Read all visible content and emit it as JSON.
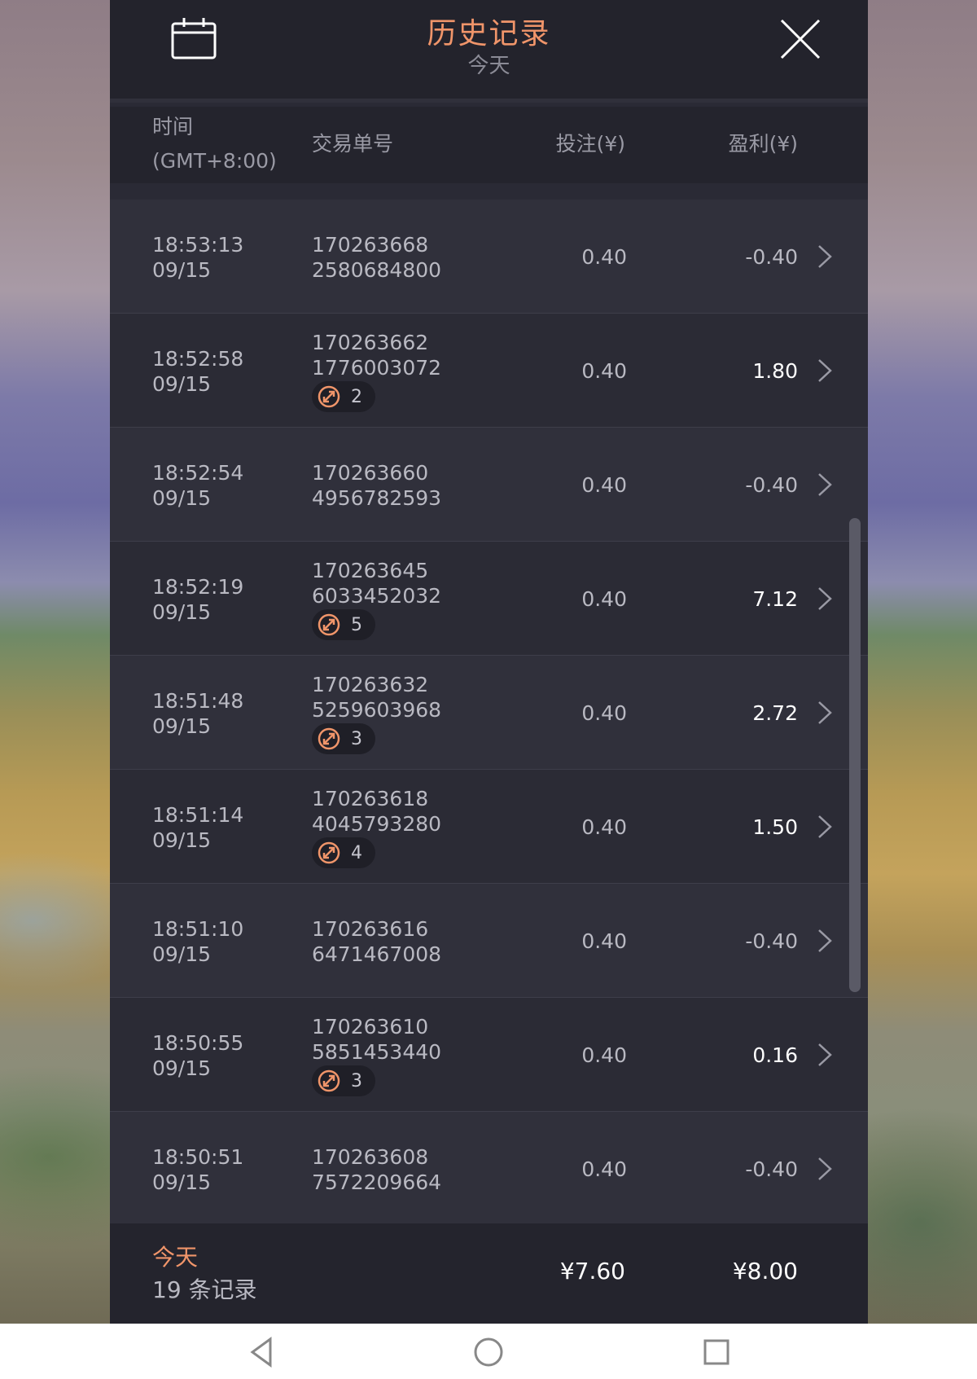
{
  "header": {
    "title": "历史记录",
    "subtitle": "今天",
    "calendar_icon": "calendar-icon",
    "close_icon": "close-icon"
  },
  "table": {
    "headers": {
      "time": "时间",
      "timezone": "(GMT+8:00)",
      "order": "交易单号",
      "bet": "投注(¥)",
      "profit": "盈利(¥)"
    },
    "rows": [
      {
        "time": "18:53:13",
        "date": "09/15",
        "order_1": "170263668",
        "order_2": "2580684800",
        "bet": "0.40",
        "profit": "-0.40"
      },
      {
        "time": "18:52:58",
        "date": "09/15",
        "order_1": "170263662",
        "order_2": "1776003072",
        "badge": "2",
        "bet": "0.40",
        "profit": "1.80"
      },
      {
        "time": "18:52:54",
        "date": "09/15",
        "order_1": "170263660",
        "order_2": "4956782593",
        "bet": "0.40",
        "profit": "-0.40"
      },
      {
        "time": "18:52:19",
        "date": "09/15",
        "order_1": "170263645",
        "order_2": "6033452032",
        "badge": "5",
        "bet": "0.40",
        "profit": "7.12"
      },
      {
        "time": "18:51:48",
        "date": "09/15",
        "order_1": "170263632",
        "order_2": "5259603968",
        "badge": "3",
        "bet": "0.40",
        "profit": "2.72"
      },
      {
        "time": "18:51:14",
        "date": "09/15",
        "order_1": "170263618",
        "order_2": "4045793280",
        "badge": "4",
        "bet": "0.40",
        "profit": "1.50"
      },
      {
        "time": "18:51:10",
        "date": "09/15",
        "order_1": "170263616",
        "order_2": "6471467008",
        "bet": "0.40",
        "profit": "-0.40"
      },
      {
        "time": "18:50:55",
        "date": "09/15",
        "order_1": "170263610",
        "order_2": "5851453440",
        "badge": "3",
        "bet": "0.40",
        "profit": "0.16"
      },
      {
        "time": "18:50:51",
        "date": "09/15",
        "order_1": "170263608",
        "order_2": "7572209664",
        "bet": "0.40",
        "profit": "-0.40"
      }
    ]
  },
  "footer": {
    "today": "今天",
    "count": "19 条记录",
    "total_bet": "¥7.60",
    "total_profit": "¥8.00"
  },
  "colors": {
    "accent": "#f0956a",
    "panel": "#2a2a35",
    "text_muted": "#b9b9c2"
  }
}
